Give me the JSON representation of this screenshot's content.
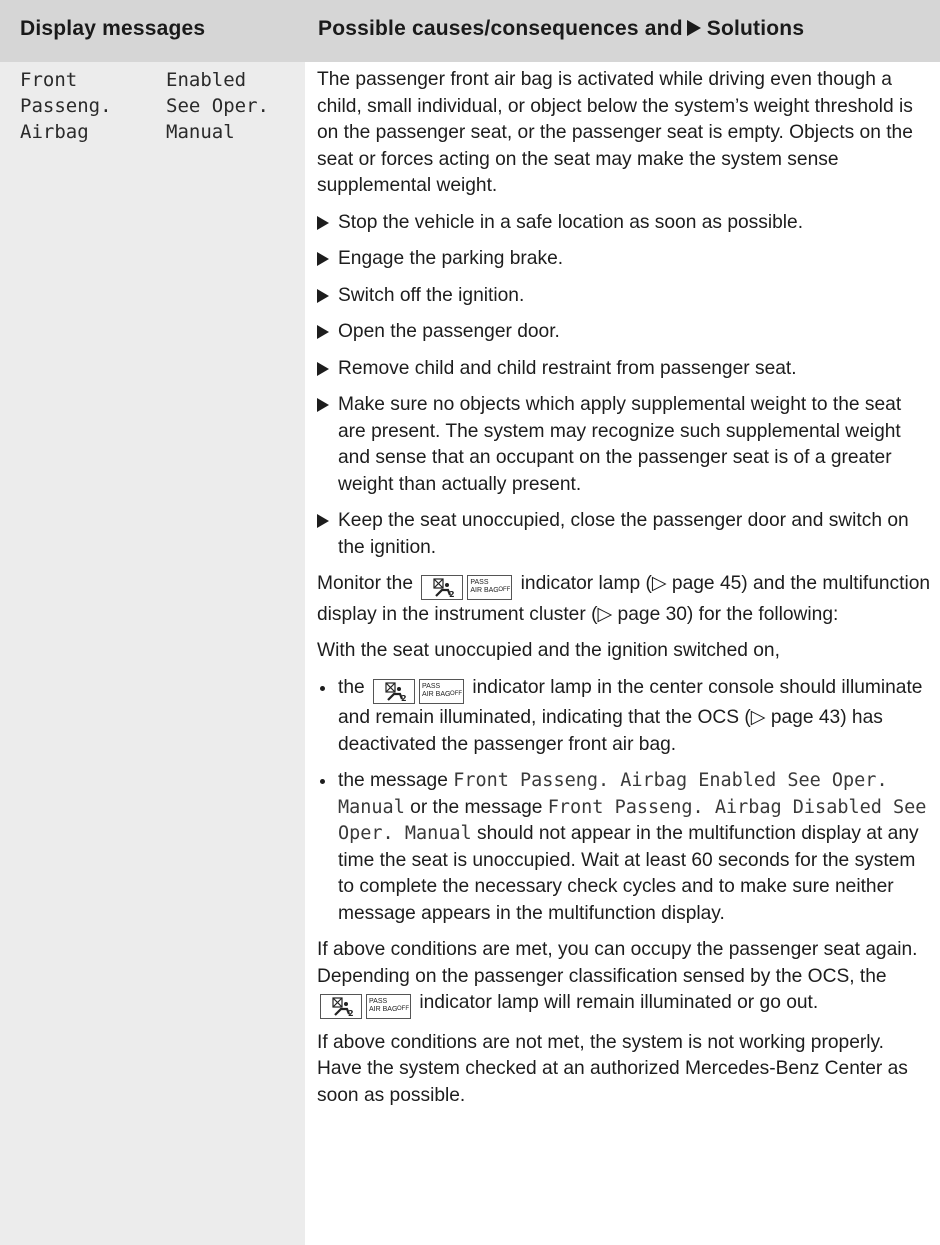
{
  "header": {
    "left_title": "Display messages",
    "right_title_prefix": "Possible causes/consequences and",
    "right_title_suffix": "Solutions"
  },
  "message": {
    "line_a": [
      "Front",
      "Passeng.",
      "Airbag"
    ],
    "line_b": [
      "Enabled",
      "See Oper.",
      "Manual"
    ]
  },
  "cause": "The passenger front air bag is activated while driving even though a child, small individual, or object below the system’s weight threshold is on the passenger seat, or the passenger seat is empty. Objects on the seat or forces acting on the seat may make the system sense supplemental weight.",
  "steps": [
    "Stop the vehicle in a safe location as soon as possible.",
    "Engage the parking brake.",
    "Switch off the ignition.",
    "Open the passenger door.",
    "Remove child and child restraint from passenger seat.",
    "Make sure no objects which apply supplemental weight to the seat are present. The system may recognize such supplemental weight and sense that an occupant on the passenger seat is of a greater weight than actually present.",
    "Keep the seat unoccupied, close the passenger door and switch on the ignition."
  ],
  "monitor": {
    "prefix": "Monitor the",
    "middle": "indicator lamp (▷ page 45) and the multifunction display in the instrument cluster (▷ page 30) for the following:"
  },
  "lamp": {
    "pass_label": "PASS",
    "airbag_label": "AIR BAG",
    "off_label": "OFF",
    "icon": "passenger-seat-occupancy-icon"
  },
  "with_seat": "With the seat unoccupied and the ignition switched on,",
  "bullet1": {
    "prefix": "the",
    "rest": "indicator lamp in the center console should illuminate and remain illuminated, indicating that the OCS (▷ page 43) has deactivated the passenger front air bag."
  },
  "bullet2": {
    "t1": "the message ",
    "m1": "Front Passeng. Airbag Enabled See Oper. Manual",
    "t2": " or the message ",
    "m2": "Front Passeng. Airbag Disabled See Oper. Manual",
    "t3": " should not appear in the multifunction display at any time the seat is unoccupied. Wait at least 60 seconds for the system to complete the necessary check cycles and to make sure neither message appears in the multifunction display."
  },
  "met": {
    "prefix": "If above conditions are met, you can occupy the passenger seat again. Depending on the passenger classification sensed by the OCS, the",
    "suffix": "indicator lamp will remain illuminated or go out."
  },
  "not_met": "If above conditions are not met, the system is not working properly. Have the system checked at an authorized Mercedes-Benz Center as soon as possible."
}
